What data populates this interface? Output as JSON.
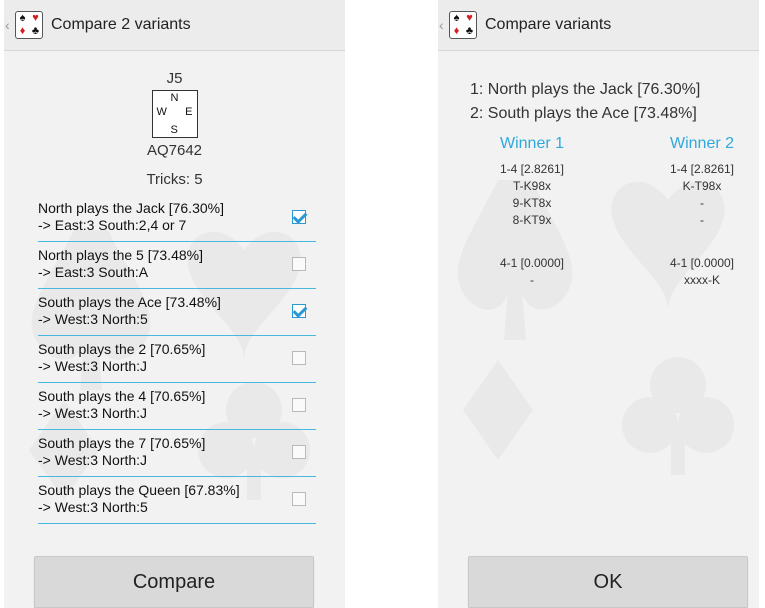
{
  "left": {
    "title": "Compare 2 variants",
    "deal": {
      "north": "J5",
      "compass": {
        "n": "N",
        "w": "W",
        "e": "E",
        "s": "S"
      },
      "south": "AQ7642",
      "tricks": "Tricks: 5"
    },
    "variants": [
      {
        "line1": "North plays the Jack [76.30%]",
        "line2": "-> East:3  South:2,4 or 7",
        "checked": true
      },
      {
        "line1": "North plays the 5 [73.48%]",
        "line2": "-> East:3  South:A",
        "checked": false
      },
      {
        "line1": "South plays the Ace [73.48%]",
        "line2": "-> West:3  North:5",
        "checked": true
      },
      {
        "line1": "South plays the 2 [70.65%]",
        "line2": "-> West:3  North:J",
        "checked": false
      },
      {
        "line1": "South plays the 4 [70.65%]",
        "line2": "-> West:3  North:J",
        "checked": false
      },
      {
        "line1": "South plays the 7 [70.65%]",
        "line2": "-> West:3  North:J",
        "checked": false
      },
      {
        "line1": "South plays the Queen [67.83%]",
        "line2": "-> West:3  North:5",
        "checked": false
      }
    ],
    "compare_label": "Compare"
  },
  "right": {
    "title": "Compare variants",
    "line1": "1: North plays the Jack [76.30%]",
    "line2": "2: South plays the Ace [73.48%]",
    "winner1": {
      "header": "Winner 1",
      "group1": [
        "1-4 [2.8261]",
        "T-K98x",
        "9-KT8x",
        "8-KT9x"
      ],
      "group2": [
        "4-1 [0.0000]",
        "-"
      ]
    },
    "winner2": {
      "header": "Winner 2",
      "group1": [
        "1-4 [2.8261]",
        "K-T98x",
        "-",
        "-"
      ],
      "group2": [
        "4-1 [0.0000]",
        "xxxx-K"
      ]
    },
    "ok_label": "OK"
  },
  "icon": {
    "tl": "♠",
    "tr": "♥",
    "bl": "♦",
    "br": "♣"
  },
  "colors": {
    "accent": "#30a8dc",
    "divider": "#49b8de",
    "button": "#d9d9d9",
    "background": "#f2f2f2"
  }
}
